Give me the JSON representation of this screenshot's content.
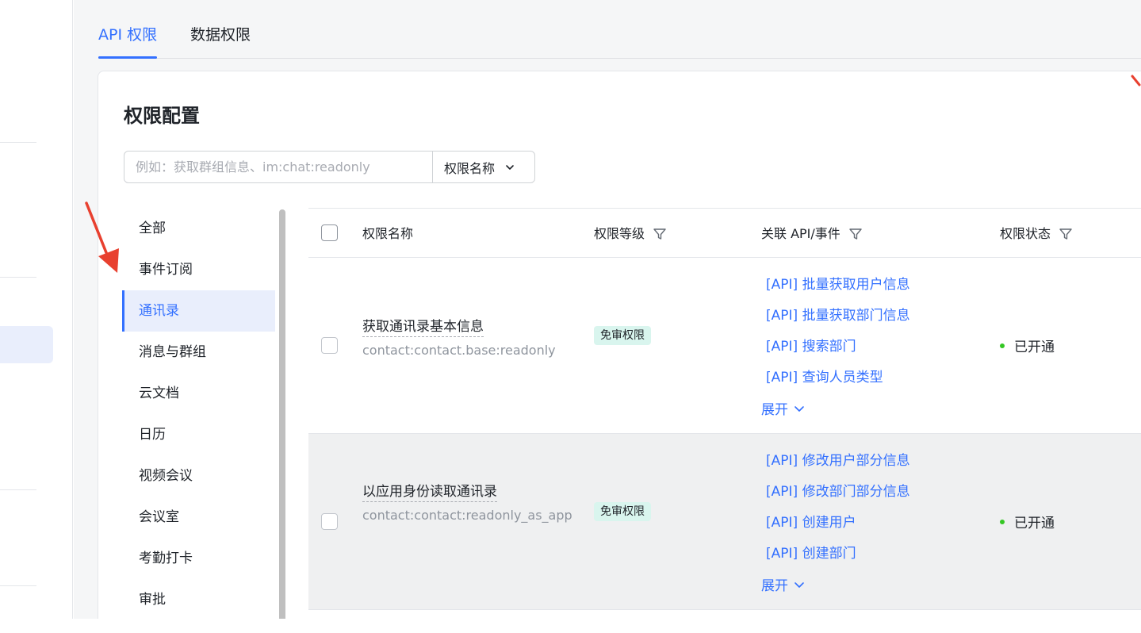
{
  "tabs": [
    {
      "label": "API 权限",
      "active": true
    },
    {
      "label": "数据权限",
      "active": false
    }
  ],
  "card": {
    "title": "权限配置",
    "search": {
      "placeholder": "例如：获取群组信息、im:chat:readonly",
      "value": "",
      "select_label": "权限名称"
    }
  },
  "categories": [
    {
      "label": "全部",
      "active": false
    },
    {
      "label": "事件订阅",
      "active": false
    },
    {
      "label": "通讯录",
      "active": true
    },
    {
      "label": "消息与群组",
      "active": false
    },
    {
      "label": "云文档",
      "active": false
    },
    {
      "label": "日历",
      "active": false
    },
    {
      "label": "视频会议",
      "active": false
    },
    {
      "label": "会议室",
      "active": false
    },
    {
      "label": "考勤打卡",
      "active": false
    },
    {
      "label": "审批",
      "active": false
    }
  ],
  "table": {
    "columns": {
      "name": "权限名称",
      "level": "权限等级",
      "api": "关联 API/事件",
      "status": "权限状态"
    },
    "rows": [
      {
        "name": "获取通讯录基本信息",
        "code": "contact:contact.base:readonly",
        "level": "免审权限",
        "apis": [
          "[API] 批量获取用户信息",
          "[API] 批量获取部门信息",
          "[API] 搜索部门",
          "[API] 查询人员类型"
        ],
        "expand_label": "展开",
        "status": "已开通"
      },
      {
        "name": "以应用身份读取通讯录",
        "code": "contact:contact:readonly_as_app",
        "level": "免审权限",
        "apis": [
          "[API] 修改用户部分信息",
          "[API] 修改部门部分信息",
          "[API] 创建用户",
          "[API] 创建部门"
        ],
        "expand_label": "展开",
        "status": "已开通"
      }
    ]
  },
  "colors": {
    "accent": "#3370ff",
    "badge_bg": "#d9f5ee",
    "status_ok": "#34c724",
    "annotation_arrow": "#e8402f"
  },
  "icons": {
    "select_chevron": "chevron-down-icon",
    "column_filter": "filter-icon",
    "expand_chevron": "chevron-down-icon",
    "annotation": "red-arrow-annotation"
  }
}
